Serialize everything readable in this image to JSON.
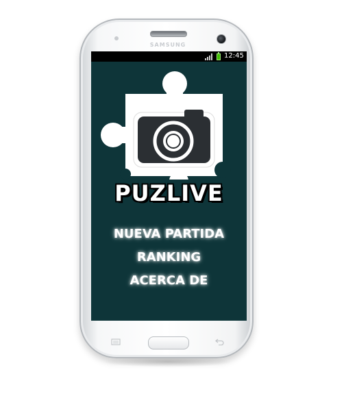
{
  "device": {
    "brand": "SAMSUNG",
    "body_color": "#ffffff",
    "screen_bg_color": "#0e3539"
  },
  "statusbar": {
    "time": "12:45",
    "icons": [
      "signal-icon",
      "battery-icon"
    ],
    "battery_color": "#40c000"
  },
  "app": {
    "logo_icon": "puzzle-camera-icon",
    "title": "PUZLIVE"
  },
  "menu": {
    "items": [
      {
        "label": "NUEVA PARTIDA"
      },
      {
        "label": "RANKING"
      },
      {
        "label": "ACERCA DE"
      }
    ]
  },
  "hardware_keys": {
    "left": "menu-key-icon",
    "center": "home-button",
    "right": "back-key-icon"
  }
}
